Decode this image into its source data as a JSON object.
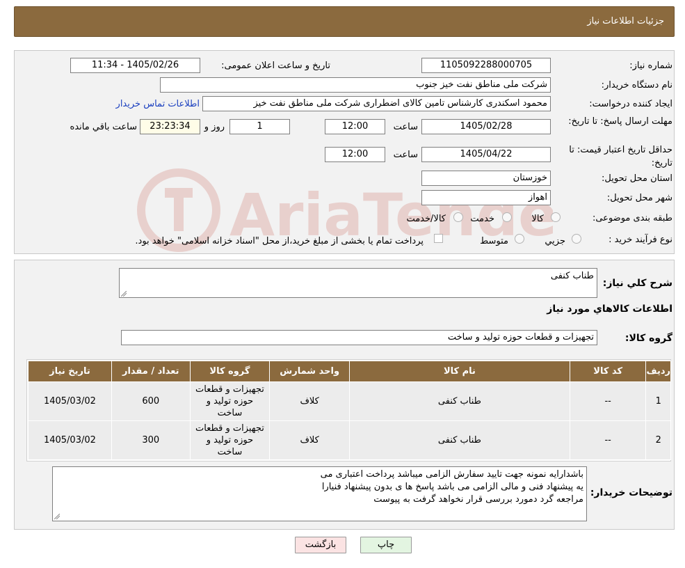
{
  "header": {
    "title": "جزئیات اطلاعات نیاز"
  },
  "form": {
    "need_number_label": "شماره نیاز:",
    "need_number": "1105092288000705",
    "announce_label": "تاریخ و ساعت اعلان عمومی:",
    "announce_value": "1405/02/26 - 11:34",
    "buyer_org_label": "نام دستگاه خریدار:",
    "buyer_org": "شرکت ملی مناطق نفت خیز جنوب",
    "requester_label": "ایجاد کننده درخواست:",
    "requester": "محمود  اسکندری کارشناس تامین کالای اضطراری شرکت ملی مناطق نفت خیز",
    "contact_link": "اطلاعات تماس خریدار",
    "deadline_label": "مهلت ارسال پاسخ: تا تاریخ:",
    "deadline_date": "1405/02/28",
    "time_label": "ساعت",
    "deadline_time": "12:00",
    "days_value": "1",
    "days_label": "روز و",
    "remaining_time": "23:23:34",
    "remaining_label": "ساعت باقي مانده",
    "validity_label": "حداقل تاریخ اعتبار قیمت: تا تاریخ:",
    "validity_date": "1405/04/22",
    "validity_time": "12:00",
    "province_label": "استان محل تحویل:",
    "province": "خوزستان",
    "city_label": "شهر محل تحویل:",
    "city": "اهواز",
    "category_label": "طبقه بندی موضوعی:",
    "category_options": [
      "کالا",
      "خدمت",
      "کالا/خدمت"
    ],
    "process_label": "نوع فرآیند خرید :",
    "process_options": [
      "جزیي",
      "متوسط"
    ],
    "payment_note": "پرداخت تمام یا بخشی از مبلغ خرید،از محل \"اسناد خزانه اسلامی\" خواهد بود."
  },
  "summary": {
    "desc_label": "شرح كلي نياز:",
    "desc_value": "طناب کنفی",
    "items_title": "اطلاعات كالاهاي مورد نياز",
    "group_label": "گروه کالا:",
    "group_value": "تجهیزات و قطعات حوزه تولید و ساخت"
  },
  "table": {
    "headers": [
      "رديف",
      "کد کالا",
      "نام کالا",
      "واحد شمارش",
      "گروه کالا",
      "تعداد / مقدار",
      "تاریخ نیاز"
    ],
    "rows": [
      [
        "1",
        "--",
        "طناب کنفی",
        "کلاف",
        "تجهیزات و قطعات حوزه تولید و ساخت",
        "600",
        "1405/03/02"
      ],
      [
        "2",
        "--",
        "طناب کنفی",
        "کلاف",
        "تجهیزات و قطعات حوزه تولید و ساخت",
        "300",
        "1405/03/02"
      ]
    ]
  },
  "notes": {
    "label": "توضیحات خریدار:",
    "line1": "باشدارایه نمونه جهت تایید سفارش الزامی میباشد پرداخت اعتباری می",
    "line2": "یه پیشنهاد فنی و مالی الزامی می باشد پاسخ ها ی بدون پیشنهاد فنیارا",
    "line3": "مراجعه گرد دمورد بررسی قرار نخواهد گرفت به پیوست"
  },
  "buttons": {
    "back": "بازگشت",
    "print": "چاپ"
  },
  "colors": {
    "header_bg": "#8b6a3e",
    "link": "#1a3fbf",
    "back_bg": "#fbe3e3",
    "print_bg": "#e3f5e1"
  }
}
